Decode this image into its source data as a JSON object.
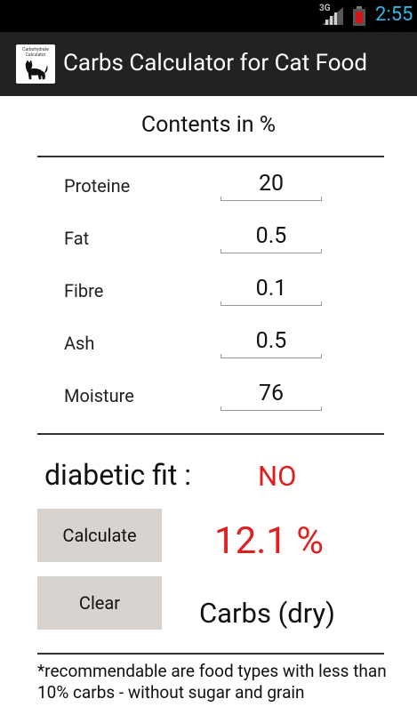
{
  "status_bar": {
    "network": "3G",
    "time": "2:55"
  },
  "action_bar": {
    "icon_caption": "Carbohydrate Calculator",
    "title": "Carbs Calculator for Cat Food"
  },
  "form": {
    "heading": "Contents in %",
    "rows": [
      {
        "label": "Proteine",
        "value": "20"
      },
      {
        "label": "Fat",
        "value": "0.5"
      },
      {
        "label": "Fibre",
        "value": "0.1"
      },
      {
        "label": "Ash",
        "value": "0.5"
      },
      {
        "label": "Moisture",
        "value": "76"
      }
    ]
  },
  "result": {
    "diabetic_label": "diabetic fit :",
    "diabetic_value": "NO",
    "carbs_value": "12.1 %",
    "carbs_label": "Carbs (dry)"
  },
  "buttons": {
    "calculate": "Calculate",
    "clear": "Clear"
  },
  "footnote": "*recommendable are food types with less than 10% carbs - without sugar and grain",
  "colors": {
    "accent_red": "#e02020",
    "clock_blue": "#33b5e5",
    "button_bg": "#d9d3d0"
  }
}
